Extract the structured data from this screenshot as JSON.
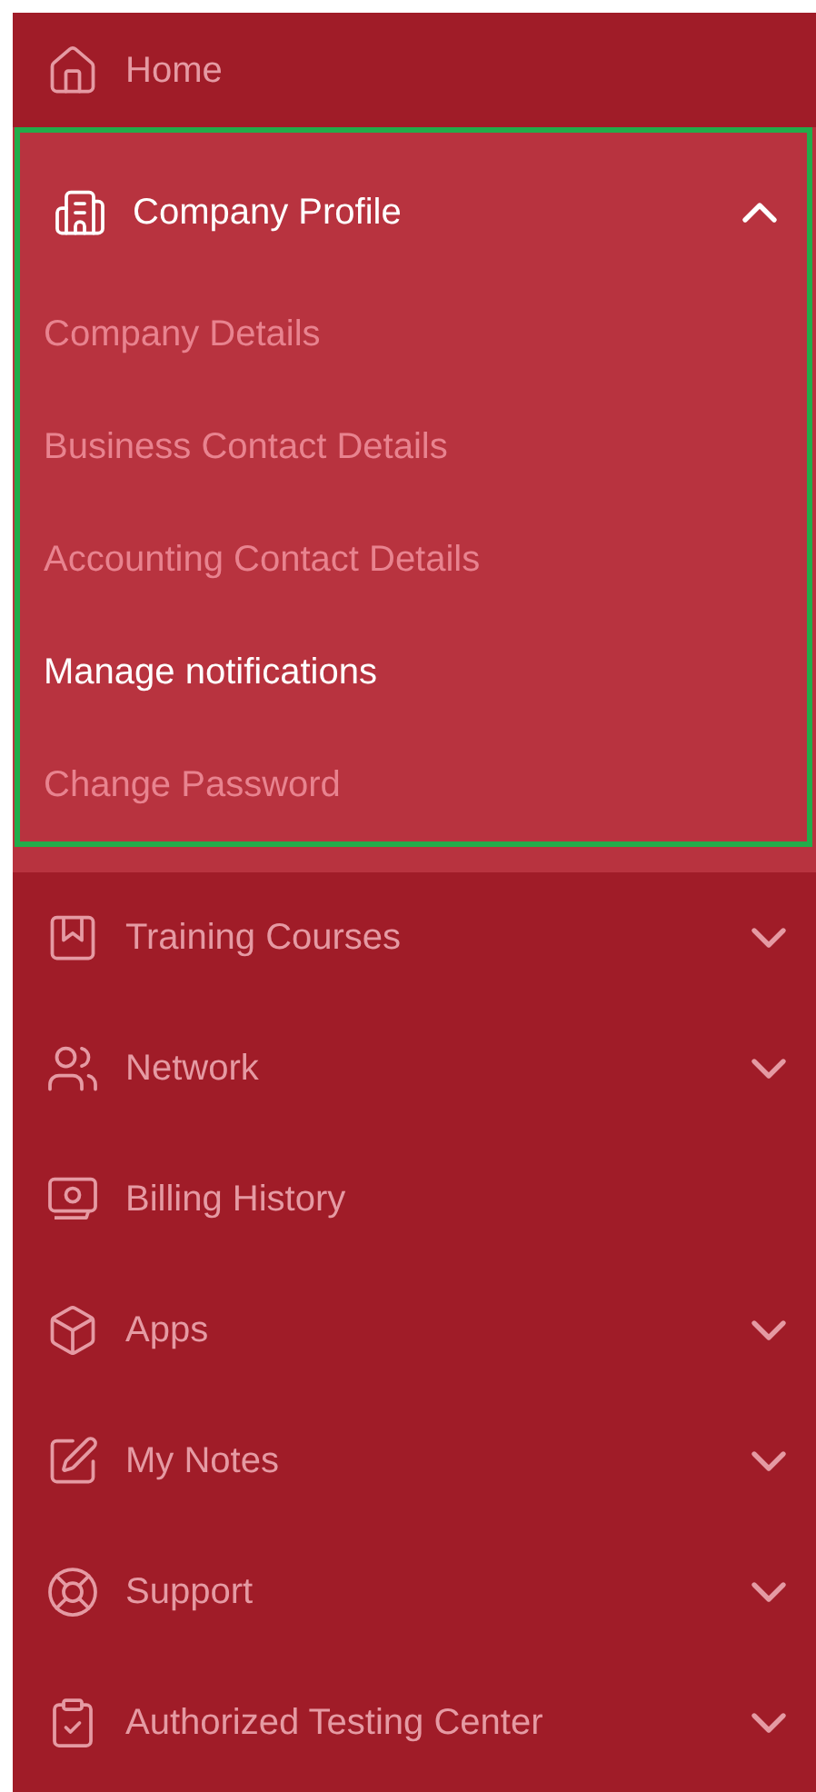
{
  "nav": [
    {
      "label": "Home",
      "has_submenu": false
    },
    {
      "label": "Company Profile",
      "has_submenu": true,
      "expanded": true,
      "highlighted": true,
      "children": [
        {
          "label": "Company Details",
          "selected": false
        },
        {
          "label": "Business Contact Details",
          "selected": false
        },
        {
          "label": "Accounting Contact Details",
          "selected": false
        },
        {
          "label": "Manage notifications",
          "selected": true
        },
        {
          "label": "Change Password",
          "selected": false
        }
      ]
    },
    {
      "label": "Training Courses",
      "has_submenu": true,
      "expanded": false
    },
    {
      "label": "Network",
      "has_submenu": true,
      "expanded": false
    },
    {
      "label": "Billing History",
      "has_submenu": false
    },
    {
      "label": "Apps",
      "has_submenu": true,
      "expanded": false
    },
    {
      "label": "My Notes",
      "has_submenu": true,
      "expanded": false
    },
    {
      "label": "Support",
      "has_submenu": true,
      "expanded": false
    },
    {
      "label": "Authorized Testing Center",
      "has_submenu": true,
      "expanded": false
    }
  ]
}
